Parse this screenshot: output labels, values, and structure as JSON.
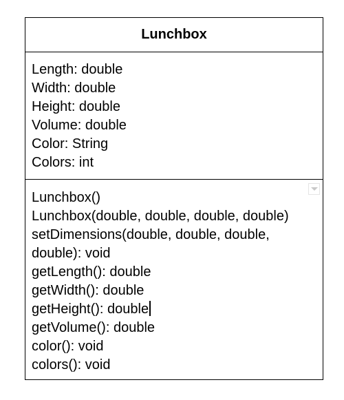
{
  "class": {
    "name": "Lunchbox",
    "attributes": [
      "Length: double",
      "Width: double",
      "Height: double",
      "Volume: double",
      "Color: String",
      "Colors: int"
    ],
    "methods": [
      "Lunchbox()",
      "Lunchbox(double, double, double, double)",
      "setDimensions(double, double, double,",
      "double): void",
      "getLength(): double",
      "getWidth(): double",
      "getHeight(): double",
      "getVolume(): double",
      "color(): void",
      "colors(): void"
    ]
  },
  "icons": {
    "dropdown": "chevron-down-icon",
    "cursor": "text-cursor"
  }
}
